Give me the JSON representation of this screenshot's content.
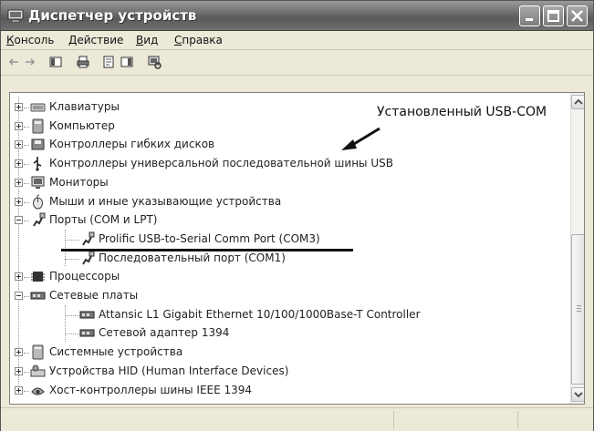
{
  "window": {
    "title": "Диспетчер устройств",
    "title_icon": "computer-monitor-icon"
  },
  "menu": [
    {
      "u": "К",
      "rest": "онсоль"
    },
    {
      "u": "Д",
      "rest": "ействие"
    },
    {
      "u": "В",
      "rest": "ид"
    },
    {
      "u": "С",
      "rest": "правка"
    }
  ],
  "toolbar_icons": [
    "back-arrow-icon",
    "forward-arrow-icon",
    "view-toggle-icon",
    "print-icon",
    "properties-icon",
    "update-driver-icon",
    "scan-hardware-icon"
  ],
  "tree": [
    {
      "label": "Клавиатуры",
      "icon": "keyboard-icon",
      "level": 0,
      "expander": "plus"
    },
    {
      "label": "Компьютер",
      "icon": "computer-icon",
      "level": 0,
      "expander": "plus"
    },
    {
      "label": "Контроллеры гибких дисков",
      "icon": "floppy-controller-icon",
      "level": 0,
      "expander": "plus"
    },
    {
      "label": "Контроллеры универсальной последовательной шины USB",
      "icon": "usb-icon",
      "level": 0,
      "expander": "plus"
    },
    {
      "label": "Мониторы",
      "icon": "monitor-icon",
      "level": 0,
      "expander": "plus"
    },
    {
      "label": "Мыши и иные указывающие устройства",
      "icon": "mouse-icon",
      "level": 0,
      "expander": "plus"
    },
    {
      "label": "Порты (COM и LPT)",
      "icon": "port-icon",
      "level": 0,
      "expander": "minus"
    },
    {
      "label": "Prolific USB-to-Serial Comm Port (COM3)",
      "icon": "port-icon",
      "level": 1,
      "expander": "none"
    },
    {
      "label": "Последовательный порт (COM1)",
      "icon": "port-icon",
      "level": 1,
      "expander": "none"
    },
    {
      "label": "Процессоры",
      "icon": "processor-icon",
      "level": 0,
      "expander": "plus"
    },
    {
      "label": "Сетевые платы",
      "icon": "network-card-icon",
      "level": 0,
      "expander": "minus"
    },
    {
      "label": "Attansic L1 Gigabit Ethernet 10/100/1000Base-T Controller",
      "icon": "network-card-icon",
      "level": 1,
      "expander": "none"
    },
    {
      "label": "Сетевой адаптер 1394",
      "icon": "network-card-icon",
      "level": 1,
      "expander": "none"
    },
    {
      "label": "Системные устройства",
      "icon": "system-device-icon",
      "level": 0,
      "expander": "plus"
    },
    {
      "label": "Устройства HID (Human Interface Devices)",
      "icon": "hid-icon",
      "level": 0,
      "expander": "plus"
    },
    {
      "label": "Хост-контроллеры шины IEEE 1394",
      "icon": "ieee1394-icon",
      "level": 0,
      "expander": "plus"
    }
  ],
  "annotation": {
    "text": "Установленный USB-COM"
  }
}
